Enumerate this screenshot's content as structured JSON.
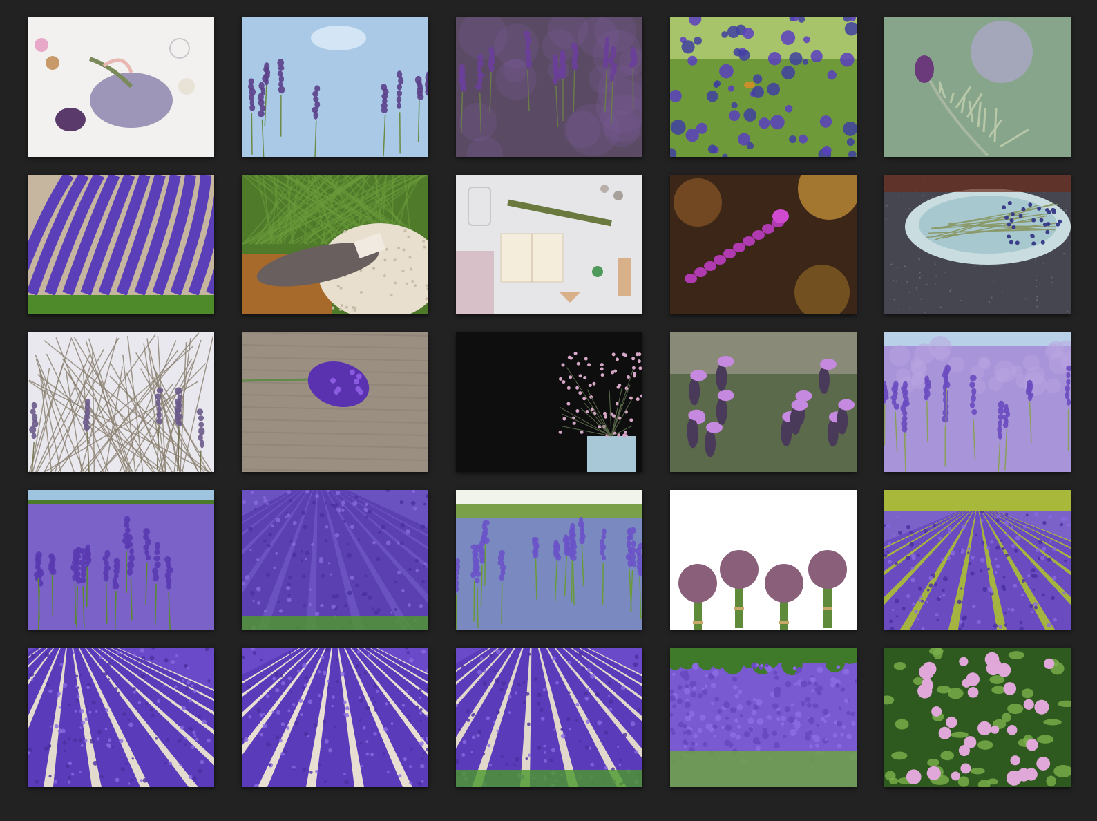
{
  "gallery": {
    "background": "#222222",
    "columns": 5,
    "rows": 5,
    "items": [
      {
        "scene": "still-life-white",
        "colors": {
          "bg": "#f2f1ef",
          "accent": "#9e96b8",
          "second": "#e8b7b2"
        }
      },
      {
        "scene": "sky-stems",
        "colors": {
          "bg": "#a9c9e6",
          "accent": "#5b3f8a",
          "second": "#6c8a45"
        }
      },
      {
        "scene": "close-bokeh",
        "colors": {
          "bg": "#5a4a63",
          "accent": "#6a3f9a",
          "second": "#8a7aa0"
        }
      },
      {
        "scene": "field-close",
        "colors": {
          "bg": "#6f9a3a",
          "accent": "#5a3fc0",
          "second": "#a8cc5a"
        }
      },
      {
        "scene": "single-sprig-green",
        "colors": {
          "bg": "#86a58a",
          "accent": "#6a3a7a",
          "second": "#b9a8d8"
        }
      },
      {
        "scene": "rows-field",
        "colors": {
          "bg": "#c6b6a0",
          "accent": "#5b3fb8",
          "second": "#4e8a2a"
        }
      },
      {
        "scene": "bundle-grass-lace",
        "colors": {
          "bg": "#4e7a2a",
          "accent": "#6a5f5f",
          "second": "#e8dfcf"
        }
      },
      {
        "scene": "flatlay-notebook",
        "colors": {
          "bg": "#e6e6e9",
          "accent": "#6a7a3f",
          "second": "#f5eddc"
        }
      },
      {
        "scene": "dark-amber-bokeh",
        "colors": {
          "bg": "#3b2618",
          "accent": "#b03ab0",
          "second": "#d09a3a"
        }
      },
      {
        "scene": "bowl-dark",
        "colors": {
          "bg": "#464650",
          "accent": "#3b3f8a",
          "second": "#c9dde0"
        }
      },
      {
        "scene": "grass-white-sky",
        "colors": {
          "bg": "#e9e8ee",
          "accent": "#6a5a8a",
          "second": "#7a7a5a"
        }
      },
      {
        "scene": "wood-single-bloom",
        "colors": {
          "bg": "#9b8f82",
          "accent": "#5a32b0",
          "second": "#5f8a4a"
        }
      },
      {
        "scene": "black-heather-pot",
        "colors": {
          "bg": "#0e0e0e",
          "accent": "#d7a7c8",
          "second": "#a8c8d8"
        }
      },
      {
        "scene": "spanish-lavender",
        "colors": {
          "bg": "#5a6a4a",
          "accent": "#c58ae0",
          "second": "#4a3a5a"
        }
      },
      {
        "scene": "soft-field-sky",
        "colors": {
          "bg": "#a894d8",
          "accent": "#6a4ac0",
          "second": "#b8d0e8"
        }
      },
      {
        "scene": "field-blue-sky",
        "colors": {
          "bg": "#7a62c8",
          "accent": "#5a3ab0",
          "second": "#9ec4e0"
        }
      },
      {
        "scene": "rows-dense",
        "colors": {
          "bg": "#6a52c0",
          "accent": "#5a3fb0",
          "second": "#4f9a2a"
        }
      },
      {
        "scene": "field-white-sky",
        "colors": {
          "bg": "#7a8ac0",
          "accent": "#6a52c8",
          "second": "#f0f4ea"
        }
      },
      {
        "scene": "bunches-white",
        "colors": {
          "bg": "#ffffff",
          "accent": "#8a5f7a",
          "second": "#5f8a3a"
        }
      },
      {
        "scene": "rows-hedge",
        "colors": {
          "bg": "#7a62c8",
          "accent": "#6a4ac0",
          "second": "#a8b83a"
        }
      },
      {
        "scene": "rows-sandy",
        "colors": {
          "bg": "#6a4ac8",
          "accent": "#5a3ab8",
          "second": "#eae3cf"
        }
      },
      {
        "scene": "rows-sandy-center",
        "colors": {
          "bg": "#6a4ac8",
          "accent": "#5a3ab8",
          "second": "#efe7d3"
        }
      },
      {
        "scene": "rows-bushes",
        "colors": {
          "bg": "#6a4ac8",
          "accent": "#5a3ab8",
          "second": "#e8dfcb"
        }
      },
      {
        "scene": "field-trees",
        "colors": {
          "bg": "#7a5ad0",
          "accent": "#6a4ac0",
          "second": "#3f7a2a"
        }
      },
      {
        "scene": "pink-flowers-green",
        "colors": {
          "bg": "#2f5a1f",
          "accent": "#e0a8d8",
          "second": "#7ab04a"
        }
      }
    ]
  }
}
